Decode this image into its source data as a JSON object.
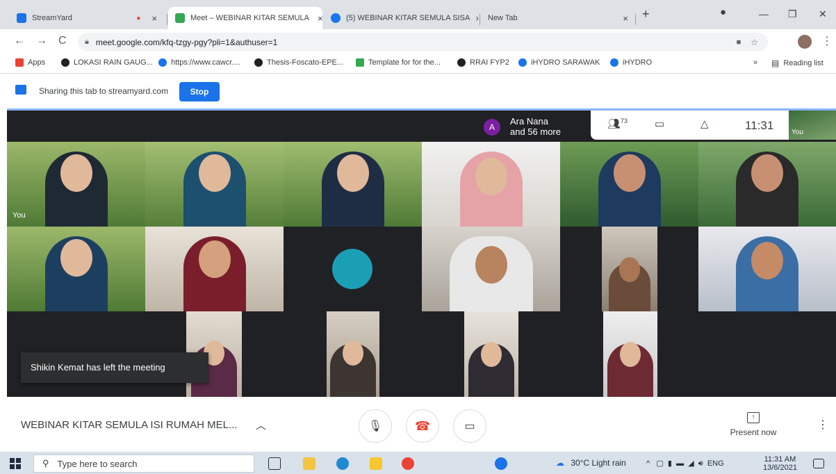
{
  "browser": {
    "tabs": [
      {
        "title": "StreamYard",
        "close": "×",
        "favicon_color": "#1a73e8"
      },
      {
        "title": "Meet – WEBINAR KITAR SEMULA",
        "close": "×",
        "favicon_color": "#34a853"
      },
      {
        "title": "(5) WEBINAR KITAR SEMULA SISA",
        "close": "×",
        "favicon_color": "#1877f2"
      },
      {
        "title": "New Tab",
        "close": "×",
        "favicon_color": "#dadce0"
      }
    ],
    "new_tab_glyph": "+",
    "url": "meet.google.com/kfq-tzgy-pgy?pli=1&authuser=1",
    "bookmarks": [
      {
        "label": "Apps",
        "color": "#ea4335"
      },
      {
        "label": "LOKASI RAIN GAUG...",
        "color": "#202124"
      },
      {
        "label": "https://www.cawcr....",
        "color": "#1a73e8"
      },
      {
        "label": "Thesis-Foscato-EPE...",
        "color": "#202124"
      },
      {
        "label": "Template for for the...",
        "color": "#34a853"
      },
      {
        "label": "RRAI FYP2",
        "color": "#202124"
      },
      {
        "label": "iHYDRO SARAWAK",
        "color": "#1a73e8"
      },
      {
        "label": "iHYDRO",
        "color": "#1a73e8"
      }
    ],
    "reading_list": "Reading list",
    "overflow": "»"
  },
  "sharing": {
    "text": "Sharing this tab to streamyard.com",
    "stop_label": "Stop"
  },
  "meet": {
    "participants_header": {
      "initial": "A",
      "line1": "Ara Nana",
      "line2": "and 56 more"
    },
    "people_count": "73",
    "clock": "11:31",
    "self_label": "You",
    "tile_self_label": "You",
    "toast": "Shikin Kemat has left the meeting",
    "meeting_name": "WEBINAR KITAR SEMULA ISI RUMAH MEL...",
    "present_label": "Present now"
  },
  "taskbar": {
    "search_placeholder": "Type here to search",
    "weather": "30°C  Light rain",
    "lang": "ENG",
    "time": "11:31 AM",
    "date": "13/6/2021"
  },
  "colors": {
    "accent": "#1a73e8",
    "meet_bg": "#202124",
    "end_call": "#ea4335"
  }
}
